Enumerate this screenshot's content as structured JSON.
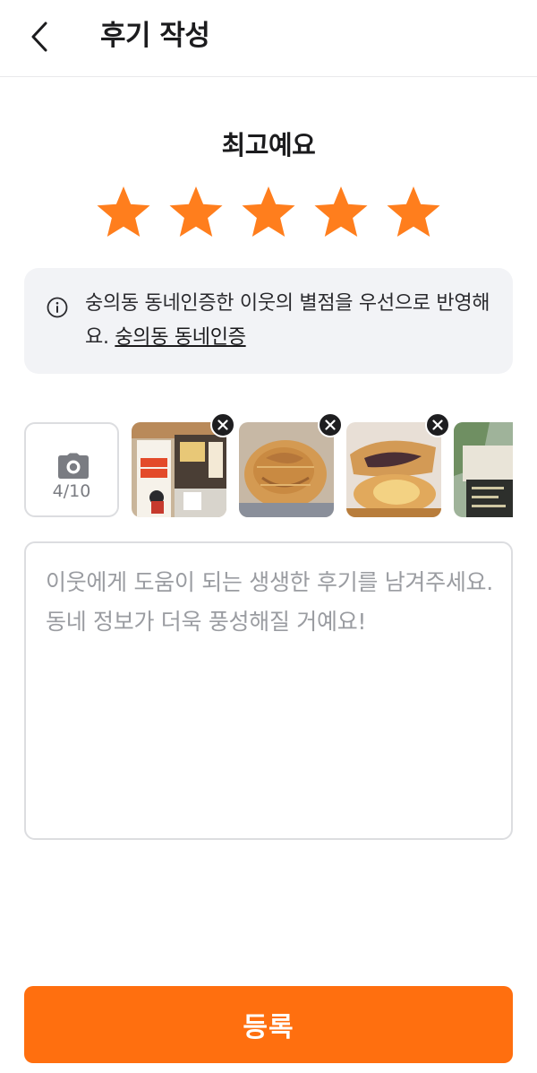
{
  "header": {
    "title": "후기 작성",
    "back_icon": "chevron-left-icon"
  },
  "rating": {
    "label": "최고예요",
    "value": 5,
    "max": 5,
    "color": "#ff7e1d"
  },
  "notice": {
    "text": "숭의동 동네인증한 이웃의 별점을 우선으로 반영해요.",
    "link_label": "숭의동 동네인증",
    "icon": "info-circle-icon"
  },
  "photos": {
    "count_label": "4/10",
    "camera_icon": "camera-icon",
    "items": [
      {
        "name": "storefront-photo"
      },
      {
        "name": "fish-bread-photo"
      },
      {
        "name": "red-bean-filling-photo"
      },
      {
        "name": "menu-board-photo"
      }
    ]
  },
  "review": {
    "placeholder": "이웃에게 도움이 되는 생생한 후기를 남겨주세요. 동네 정보가 더욱 풍성해질 거예요!",
    "value": ""
  },
  "submit": {
    "label": "등록",
    "color": "#ff6f0f"
  }
}
